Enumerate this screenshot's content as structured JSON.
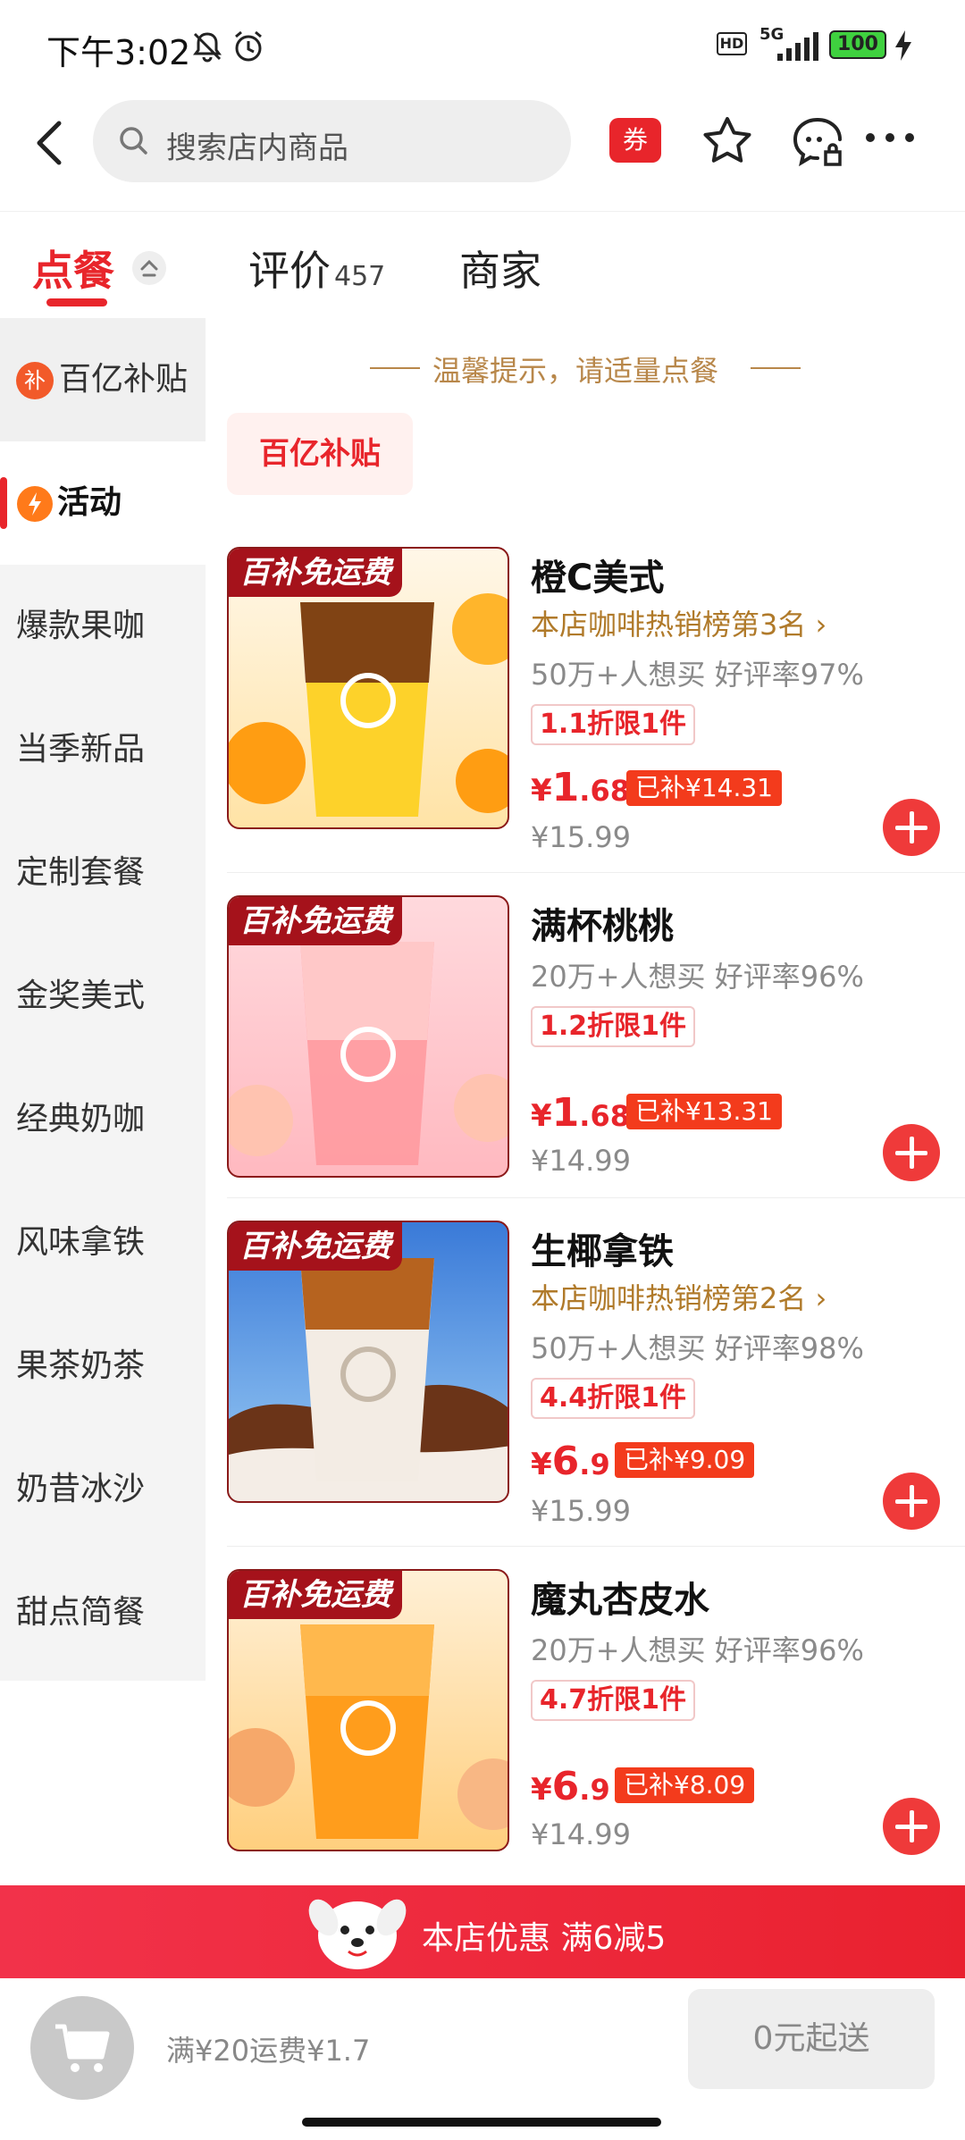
{
  "status": {
    "time": "下午3:02",
    "battery": "100",
    "network": "5G",
    "hd": "HD"
  },
  "header": {
    "search_placeholder": "搜索店内商品",
    "coupon": "券"
  },
  "tabs": [
    {
      "label": "点餐"
    },
    {
      "label": "评价",
      "count": "457"
    },
    {
      "label": "商家"
    }
  ],
  "sidebar": {
    "items": [
      {
        "label": "百亿补贴",
        "badge": "补"
      },
      {
        "label": "活动"
      },
      {
        "label": "爆款果咖"
      },
      {
        "label": "当季新品"
      },
      {
        "label": "定制套餐"
      },
      {
        "label": "金奖美式"
      },
      {
        "label": "经典奶咖"
      },
      {
        "label": "风味拿铁"
      },
      {
        "label": "果茶奶茶"
      },
      {
        "label": "奶昔冰沙"
      },
      {
        "label": "甜点简餐"
      }
    ]
  },
  "content": {
    "tip": "温馨提示，请适量点餐",
    "category": "百亿补贴",
    "products": [
      {
        "tag": "百补免运费",
        "name": "橙C美式",
        "rank": "本店咖啡热销榜第3名",
        "rank_arrow": "›",
        "wants": "50万+人想买",
        "rating": "好评率97%",
        "discount": "1.1折限1件",
        "price_symbol": "¥",
        "price_int": "1",
        "price_dec": ".68",
        "subsidy": "已补¥14.31",
        "original": "¥15.99"
      },
      {
        "tag": "百补免运费",
        "name": "满杯桃桃",
        "rank": "",
        "rank_arrow": "",
        "wants": "20万+人想买",
        "rating": "好评率96%",
        "discount": "1.2折限1件",
        "price_symbol": "¥",
        "price_int": "1",
        "price_dec": ".68",
        "subsidy": "已补¥13.31",
        "original": "¥14.99"
      },
      {
        "tag": "百补免运费",
        "name": "生椰拿铁",
        "rank": "本店咖啡热销榜第2名",
        "rank_arrow": "›",
        "wants": "50万+人想买",
        "rating": "好评率98%",
        "discount": "4.4折限1件",
        "price_symbol": "¥",
        "price_int": "6",
        "price_dec": ".9",
        "subsidy": "已补¥9.09",
        "original": "¥15.99"
      },
      {
        "tag": "百补免运费",
        "name": "魔丸杏皮水",
        "rank": "",
        "rank_arrow": "",
        "wants": "20万+人想买",
        "rating": "好评率96%",
        "discount": "4.7折限1件",
        "price_symbol": "¥",
        "price_int": "6",
        "price_dec": ".9",
        "subsidy": "已补¥8.09",
        "original": "¥14.99"
      }
    ]
  },
  "promo": {
    "text": "本店优惠  满6减5"
  },
  "bottom": {
    "fee": "满¥20运费¥1.7",
    "send": "0元起送"
  },
  "colors": {
    "accent": "#e8252b",
    "gold": "#b8874a",
    "subsidy": "#f33b1c"
  }
}
